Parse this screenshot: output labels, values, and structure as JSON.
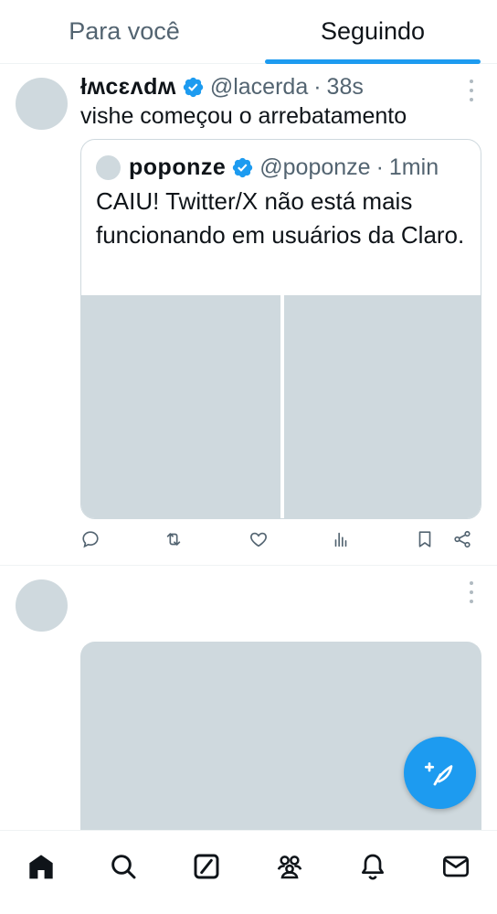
{
  "tabs": [
    {
      "label": "Para você",
      "active": false
    },
    {
      "label": "Seguindo",
      "active": true
    }
  ],
  "tweet1": {
    "display_name": "łʍcɛʌdʍ",
    "handle": "@lacerda",
    "separator": "·",
    "time": "38s",
    "text": "vishe começou o arrebatamento",
    "quote": {
      "display_name": "poponze",
      "handle": "@poponze",
      "separator": "·",
      "time": "1min",
      "text": "CAIU! Twitter/X não está mais funcionando em usuários da Claro."
    },
    "actions": [
      "reply-icon",
      "retweet-icon",
      "like-icon",
      "views-icon",
      "bookmark-icon",
      "share-icon"
    ]
  },
  "colors": {
    "accent": "#1d9bf0",
    "text_primary": "#0f1419",
    "text_secondary": "#536471",
    "placeholder": "#cfd9de",
    "divider": "#eff3f4"
  },
  "bottom_nav": [
    "home-icon",
    "search-icon",
    "grok-icon",
    "communities-icon",
    "notifications-icon",
    "messages-icon"
  ],
  "fab": {
    "icon": "compose-post-icon"
  }
}
